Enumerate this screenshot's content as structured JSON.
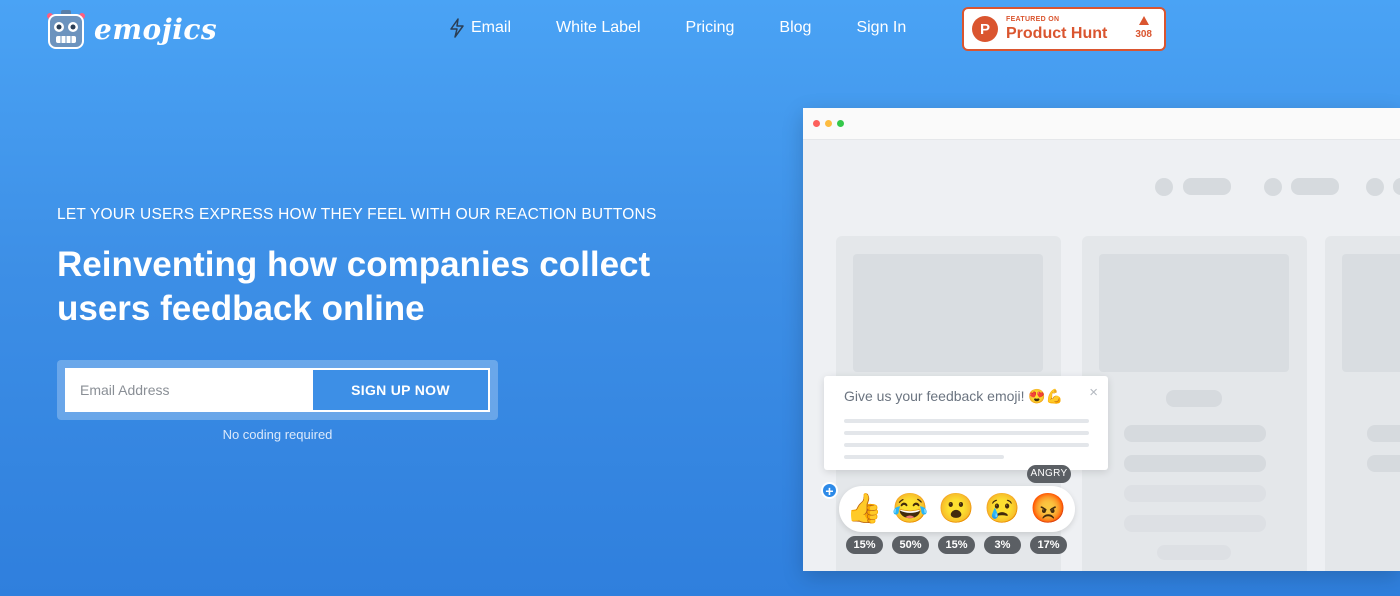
{
  "brand": {
    "name": "emojics"
  },
  "nav": {
    "links": [
      {
        "label": "Email"
      },
      {
        "label": "White Label"
      },
      {
        "label": "Pricing"
      },
      {
        "label": "Blog"
      },
      {
        "label": "Sign In"
      }
    ],
    "product_hunt": {
      "logo_letter": "P",
      "small": "FEATURED ON",
      "big": "Product Hunt",
      "votes": "308"
    }
  },
  "hero": {
    "eyebrow": "LET YOUR USERS EXPRESS HOW THEY FEEL WITH OUR REACTION BUTTONS",
    "headline_line1": "Reinventing how companies collect",
    "headline_line2": "users feedback online",
    "email_placeholder": "Email Address",
    "signup_label": "SIGN UP NOW",
    "note": "No coding required"
  },
  "mockup": {
    "widget_title": "Give us your feedback emoji! 😍💪",
    "close": "×",
    "plus": "+",
    "tooltip": "ANGRY",
    "reactions": [
      {
        "emoji": "👍",
        "percent": "15%"
      },
      {
        "emoji": "😂",
        "percent": "50%"
      },
      {
        "emoji": "😮",
        "percent": "15%"
      },
      {
        "emoji": "😢",
        "percent": "3%"
      },
      {
        "emoji": "😡",
        "percent": "17%"
      }
    ]
  },
  "colors": {
    "accent": "#3d8fe6",
    "product_hunt": "#da552f",
    "dot_red": "#fc605c",
    "dot_yellow": "#fdbc40",
    "dot_green": "#34c84a"
  }
}
